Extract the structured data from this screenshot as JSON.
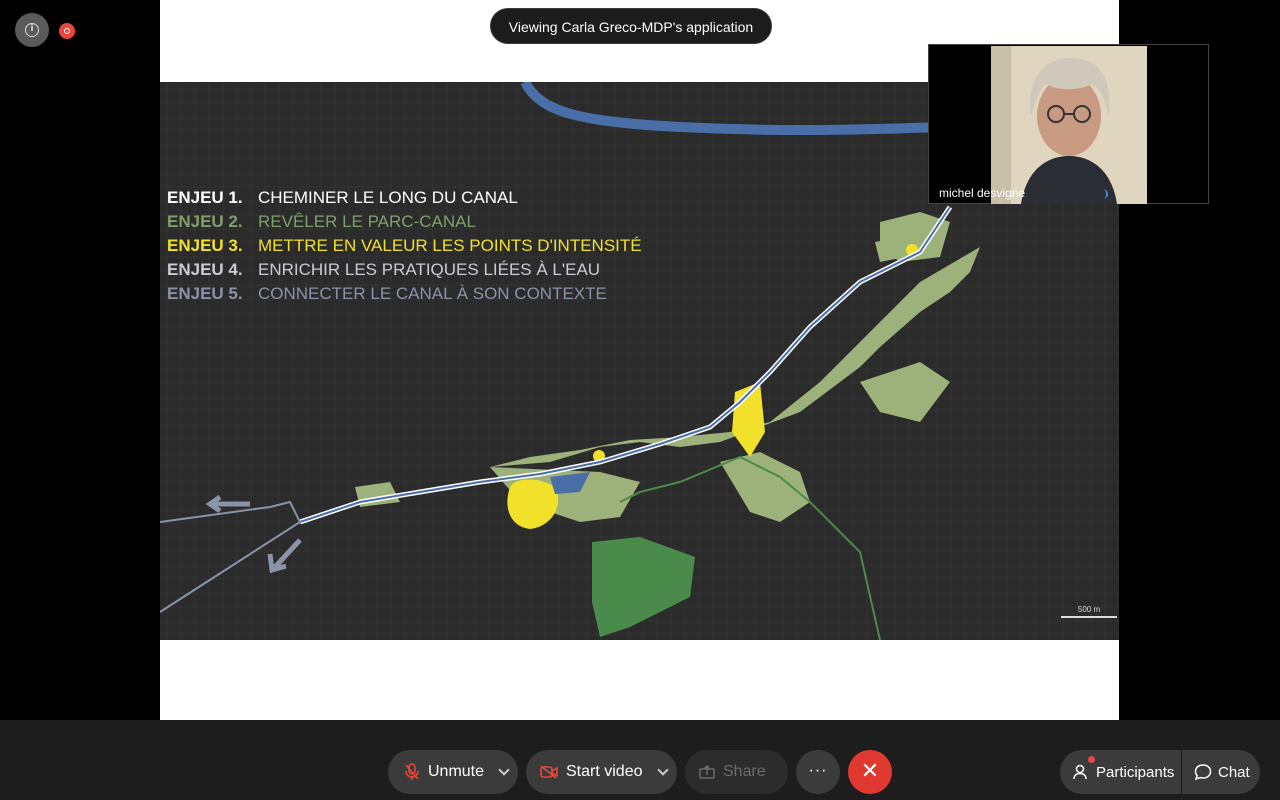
{
  "banner": {
    "viewing_text": "Viewing Carla Greco-MDP's application"
  },
  "slide": {
    "enjeux": [
      {
        "num": "ENJEU 1.",
        "text": "CHEMINER LE LONG DU CANAL",
        "color": "#ffffff"
      },
      {
        "num": "ENJEU 2.",
        "text": "REVÊLER LE PARC-CANAL",
        "color": "#7fa06a"
      },
      {
        "num": "ENJEU 3.",
        "text": "METTRE EN VALEUR LES POINTS D'INTENSITÉ",
        "color": "#f2e12b"
      },
      {
        "num": "ENJEU 4.",
        "text": "ENRICHIR LES PRATIQUES LIÉES À L'EAU",
        "color": "#c9ccd6"
      },
      {
        "num": "ENJEU 5.",
        "text": "CONNECTER LE CANAL À SON CONTEXTE",
        "color": "#8b93a8"
      }
    ],
    "scale_label": "500 m"
  },
  "video": {
    "participant_name": "michel desvigne"
  },
  "toolbar": {
    "unmute_label": "Unmute",
    "start_video_label": "Start video",
    "share_label": "Share",
    "more_label": "···",
    "end_label": "✕",
    "participants_label": "Participants",
    "chat_label": "Chat"
  },
  "colors": {
    "end_call": "#e0392f",
    "recording": "#e8473e",
    "park_green": "#9db27a",
    "highlight_yellow": "#f2e12b"
  }
}
